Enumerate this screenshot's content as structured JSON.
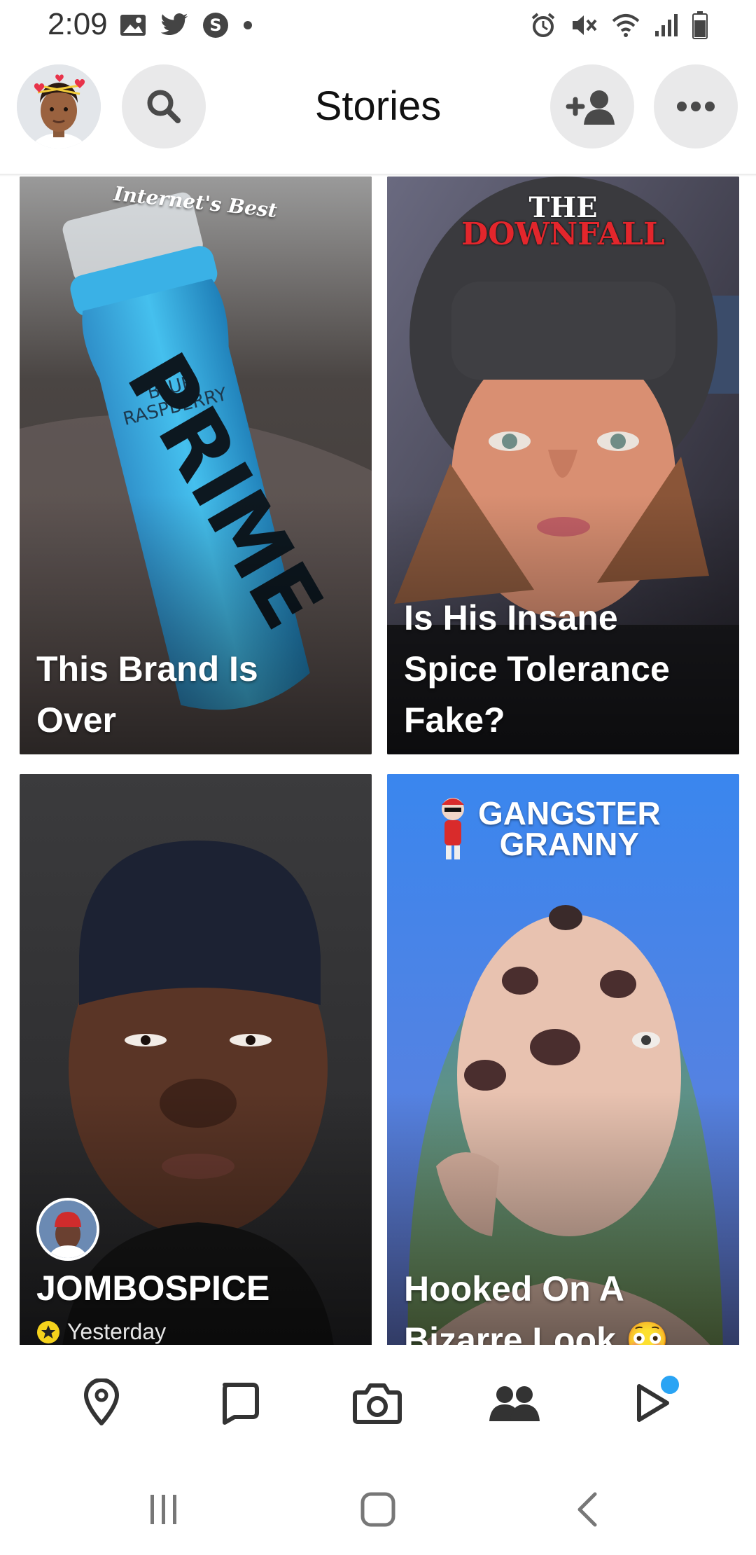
{
  "status_bar": {
    "time": "2:09",
    "left_icons": [
      "gallery-icon",
      "twitter-icon",
      "s-app-icon",
      "dot-icon"
    ],
    "right_icons": [
      "alarm-icon",
      "mute-icon",
      "wifi-icon",
      "signal-icon",
      "battery-icon"
    ]
  },
  "header": {
    "title": "Stories",
    "avatar_icon": "bitmoji-avatar",
    "search_icon": "search-icon",
    "add_friend_icon": "add-friend-icon",
    "more_icon": "more-icon"
  },
  "tiles": [
    {
      "brand": "Internet's Best",
      "title": "This Brand Is\nOver"
    },
    {
      "brand_line1": "THE",
      "brand_line2": "DOWNFALL",
      "title": "Is His Insane\nSpice Tolerance\nFake?"
    },
    {
      "title": "JOMBOSPICE",
      "subtitle": "Yesterday"
    },
    {
      "brand_line1": "GANGSTER",
      "brand_line2": "GRANNY",
      "title": "Hooked On A\nBizarre Look 😳"
    }
  ],
  "bottom_nav": {
    "items": [
      "map-icon",
      "chat-icon",
      "camera-icon",
      "friends-icon",
      "spotlight-icon"
    ],
    "badge_color": "#2aa4f4",
    "active": "friends-icon"
  },
  "system_nav": [
    "recents-icon",
    "home-icon",
    "back-icon"
  ],
  "colors": {
    "accent": "#2aa4f4",
    "button_bg": "#e9e9ea"
  }
}
